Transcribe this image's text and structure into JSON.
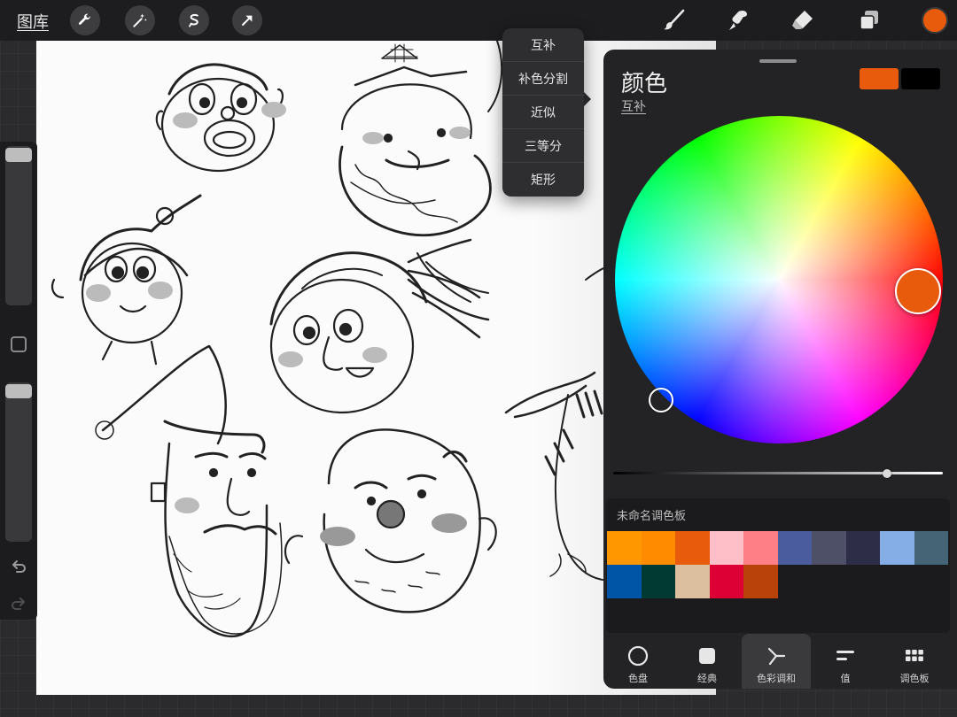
{
  "topbar": {
    "gallery_label": "图库",
    "left_tools": [
      "wrench-icon",
      "magic-wand-icon",
      "selection-icon",
      "transform-arrow-icon"
    ],
    "right_tools": [
      "brush-icon",
      "smudge-icon",
      "eraser-icon",
      "layers-icon"
    ],
    "current_color": "#e85a0c"
  },
  "harmony_menu": {
    "items": [
      "互补",
      "补色分割",
      "近似",
      "三等分",
      "矩形"
    ]
  },
  "color_panel": {
    "title": "颜色",
    "mode_label": "互补",
    "primary_color": "#e85a0c",
    "secondary_color": "#000000",
    "brightness": 0.83,
    "palette": {
      "name": "未命名调色板",
      "swatches": [
        "#ff9800",
        "#ff8c00",
        "#e85a0c",
        "#ffbfc8",
        "#ff7f86",
        "#4a5c9e",
        "#4e5068",
        "#2e2d48",
        "#86aee6",
        "#456476",
        "#0055a6",
        "#003a32",
        "#dcbf9e",
        "#dc0034",
        "#b8420a"
      ]
    },
    "tabs": [
      {
        "label": "色盘",
        "icon": "disc-icon"
      },
      {
        "label": "经典",
        "icon": "square-icon"
      },
      {
        "label": "色彩调和",
        "icon": "harmony-icon"
      },
      {
        "label": "值",
        "icon": "sliders-icon"
      },
      {
        "label": "调色板",
        "icon": "grid-icon"
      }
    ],
    "active_tab": "色彩调和"
  },
  "sidebar": {
    "brush_size": 0.95,
    "opacity": 0.95,
    "tools": [
      "modify-square-icon",
      "undo-icon",
      "redo-icon"
    ]
  }
}
